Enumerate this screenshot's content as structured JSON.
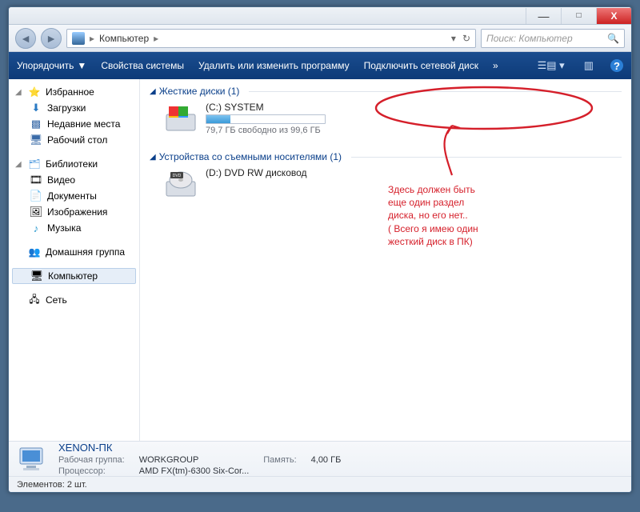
{
  "titlebar": {
    "min": "—",
    "max": "□",
    "close": "X"
  },
  "address": {
    "crumb": "Компьютер",
    "search_placeholder": "Поиск: Компьютер"
  },
  "toolbar": {
    "organize": "Упорядочить",
    "properties": "Свойства системы",
    "uninstall": "Удалить или изменить программу",
    "map_drive": "Подключить сетевой диск",
    "more": "»"
  },
  "sidebar": {
    "favorites": {
      "title": "Избранное",
      "items": [
        "Загрузки",
        "Недавние места",
        "Рабочий стол"
      ]
    },
    "libraries": {
      "title": "Библиотеки",
      "items": [
        "Видео",
        "Документы",
        "Изображения",
        "Музыка"
      ]
    },
    "homegroup": {
      "title": "Домашняя группа"
    },
    "computer": {
      "title": "Компьютер"
    },
    "network": {
      "title": "Сеть"
    }
  },
  "content": {
    "cat_hdd": "Жесткие диски (1)",
    "cat_removable": "Устройства со съемными носителями (1)",
    "drive_c": {
      "name": "(C:) SYSTEM",
      "free": "79,7 ГБ свободно из 99,6 ГБ",
      "fill_pct": 20
    },
    "drive_d": {
      "name": "(D:) DVD RW дисковод"
    }
  },
  "annotation": {
    "text": "Здесь должен быть\nеще один раздел\nдиска, но его нет..\n( Всего я имею один\nжесткий диск в ПК)"
  },
  "details": {
    "computer_name": "XENON-ПК",
    "workgroup_lbl": "Рабочая группа:",
    "workgroup_val": "WORKGROUP",
    "cpu_lbl": "Процессор:",
    "cpu_val": "AMD FX(tm)-6300 Six-Cor...",
    "mem_lbl": "Память:",
    "mem_val": "4,00 ГБ"
  },
  "status": {
    "text": "Элементов: 2 шт."
  }
}
